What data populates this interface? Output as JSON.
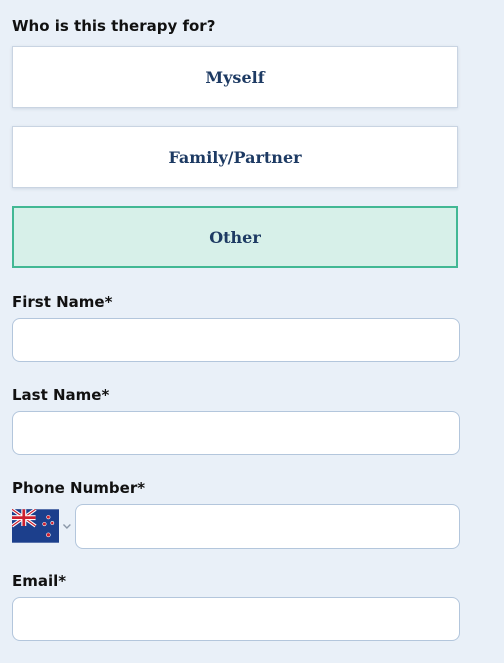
{
  "question": {
    "label": "Who is this therapy for?",
    "options": [
      {
        "label": "Myself",
        "selected": false
      },
      {
        "label": "Family/Partner",
        "selected": false
      },
      {
        "label": "Other",
        "selected": true
      }
    ]
  },
  "fields": {
    "first_name": {
      "label": "First Name*",
      "value": "",
      "placeholder": ""
    },
    "last_name": {
      "label": "Last Name*",
      "value": "",
      "placeholder": ""
    },
    "phone": {
      "label": "Phone Number*",
      "value": "",
      "placeholder": "",
      "country_flag_icon": "new-zealand-flag-icon"
    },
    "email": {
      "label": "Email*",
      "value": "",
      "placeholder": ""
    }
  },
  "colors": {
    "background": "#e9f0f8",
    "option_text": "#1d3a63",
    "selected_fill": "#d7f0e9",
    "selected_border": "#42b894",
    "input_border": "#b3c6dc"
  }
}
